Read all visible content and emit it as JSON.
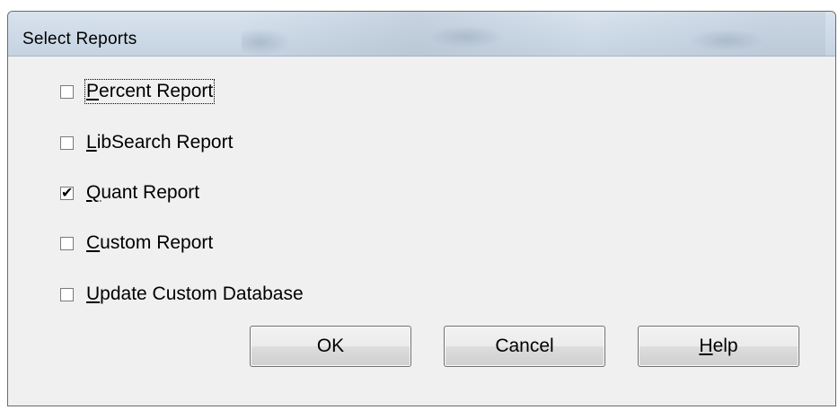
{
  "window": {
    "title": "Select Reports"
  },
  "options": [
    {
      "pre": "",
      "mnemonic": "P",
      "post": "ercent Report",
      "checked": false,
      "focused": true
    },
    {
      "pre": "",
      "mnemonic": "L",
      "post": "ibSearch Report",
      "checked": false,
      "focused": false
    },
    {
      "pre": "",
      "mnemonic": "Q",
      "post": "uant Report",
      "checked": true,
      "focused": false
    },
    {
      "pre": "",
      "mnemonic": "C",
      "post": "ustom Report",
      "checked": false,
      "focused": false
    },
    {
      "pre": "",
      "mnemonic": "U",
      "post": "pdate Custom Database",
      "checked": false,
      "focused": false
    }
  ],
  "buttons": {
    "ok": {
      "pre": "OK",
      "mnemonic": "",
      "post": ""
    },
    "cancel": {
      "pre": "Cancel",
      "mnemonic": "",
      "post": ""
    },
    "help": {
      "pre": "",
      "mnemonic": "H",
      "post": "elp"
    }
  },
  "icons": {
    "check": "check-mark-icon"
  }
}
